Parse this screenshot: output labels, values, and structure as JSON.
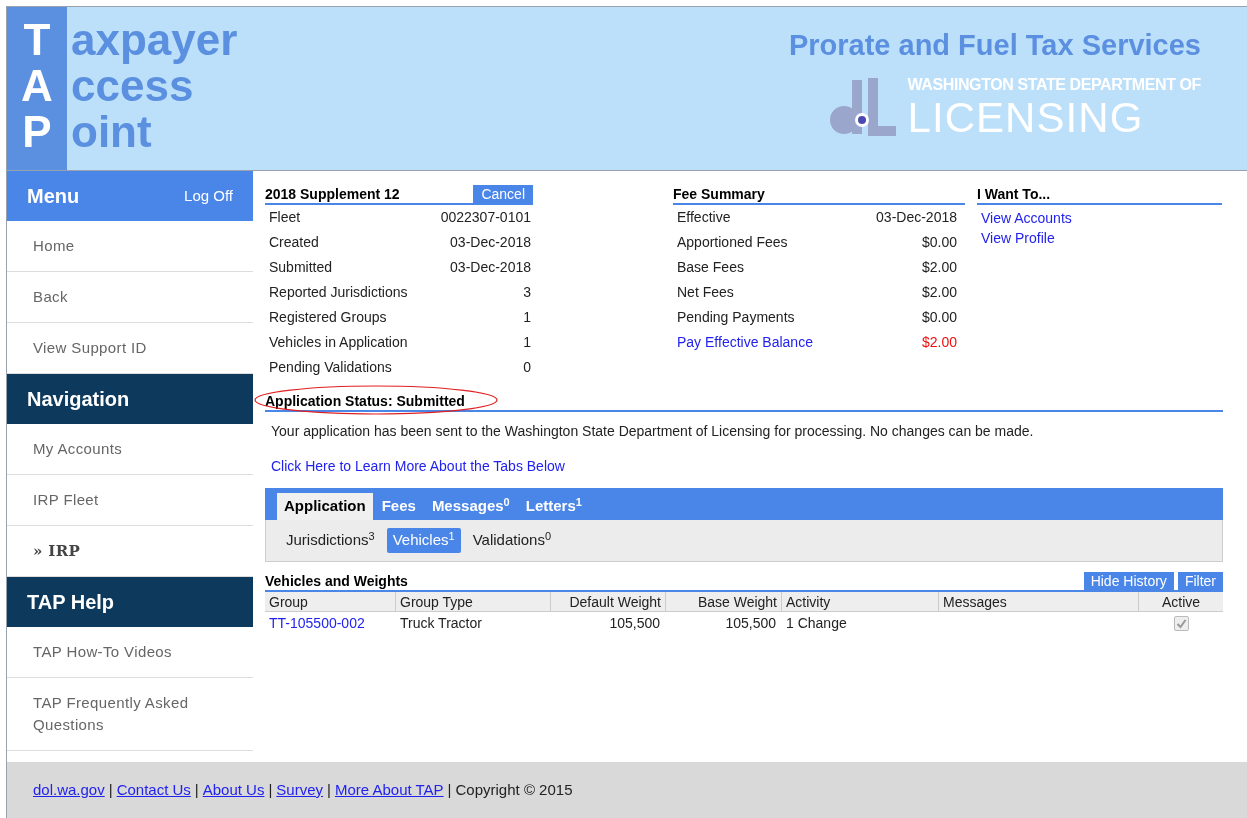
{
  "header": {
    "logo_lines": [
      {
        "initial": "T",
        "rest": "axpayer"
      },
      {
        "initial": "A",
        "rest": "ccess"
      },
      {
        "initial": "P",
        "rest": "oint"
      }
    ],
    "title": "Prorate and Fuel Tax Services",
    "agency_line": "WASHINGTON STATE DEPARTMENT OF",
    "agency_name": "LICENSING"
  },
  "sidebar": {
    "sections": [
      {
        "title": "Menu",
        "action": "Log Off",
        "items": [
          {
            "label": "Home",
            "selected": false
          },
          {
            "label": "Back",
            "selected": false
          },
          {
            "label": "View Support ID",
            "selected": false
          }
        ]
      },
      {
        "title": "Navigation",
        "items": [
          {
            "label": "My Accounts",
            "selected": false
          },
          {
            "label": "IRP Fleet",
            "selected": false
          },
          {
            "label": "» IRP",
            "selected": true
          }
        ]
      },
      {
        "title": "TAP Help",
        "items": [
          {
            "label": "TAP How-To Videos",
            "selected": false
          },
          {
            "label": "TAP Frequently Asked Questions",
            "selected": false
          }
        ]
      }
    ]
  },
  "summary": {
    "title": "2018 Supplement 12",
    "button": "Cancel",
    "rows": [
      {
        "label": "Fleet",
        "value": "0022307-0101"
      },
      {
        "label": "Created",
        "value": "03-Dec-2018"
      },
      {
        "label": "Submitted",
        "value": "03-Dec-2018"
      },
      {
        "label": "Reported Jurisdictions",
        "value": "3"
      },
      {
        "label": "Registered Groups",
        "value": "1"
      },
      {
        "label": "Vehicles in Application",
        "value": "1"
      },
      {
        "label": "Pending Validations",
        "value": "0"
      }
    ]
  },
  "fees": {
    "title": "Fee Summary",
    "rows": [
      {
        "label": "Effective",
        "value": "03-Dec-2018",
        "kind": "plain"
      },
      {
        "label": "Apportioned Fees",
        "value": "$0.00",
        "kind": "plain"
      },
      {
        "label": "Base Fees",
        "value": "$2.00",
        "kind": "plain"
      },
      {
        "label": "Net Fees",
        "value": "$2.00",
        "kind": "plain"
      },
      {
        "label": "Pending Payments",
        "value": "$0.00",
        "kind": "plain"
      },
      {
        "label": "Pay Effective Balance",
        "value": "$2.00",
        "kind": "due"
      }
    ]
  },
  "i_want_to": {
    "title": "I Want To...",
    "links": [
      "View Accounts",
      "View Profile"
    ]
  },
  "status": {
    "title": "Application Status: Submitted",
    "message": "Your application has been sent to the Washington State Department of Licensing for processing. No changes can be made.",
    "help_link": "Click Here to Learn More About the Tabs Below"
  },
  "tabs": [
    {
      "label": "Application",
      "selected": true
    },
    {
      "label": "Fees",
      "selected": false
    },
    {
      "label": "Messages",
      "count": "0",
      "selected": false
    },
    {
      "label": "Letters",
      "count": "1",
      "selected": false
    }
  ],
  "subtabs": [
    {
      "label": "Jurisdictions",
      "count": "3",
      "selected": false
    },
    {
      "label": "Vehicles",
      "count": "1",
      "selected": true
    },
    {
      "label": "Validations",
      "count": "0",
      "selected": false
    }
  ],
  "table": {
    "title": "Vehicles and Weights",
    "buttons": [
      "Hide History",
      "Filter"
    ],
    "columns": [
      "Group",
      "Group Type",
      "Default Weight",
      "Base Weight",
      "Activity",
      "Messages",
      "Active"
    ],
    "rows": [
      {
        "group": "TT-105500-002",
        "group_type": "Truck Tractor",
        "default_weight": "105,500",
        "base_weight": "105,500",
        "activity": "1 Change",
        "active": true
      }
    ]
  },
  "footer": {
    "items": [
      {
        "kind": "link",
        "text": "dol.wa.gov"
      },
      {
        "kind": "text",
        "text": "|"
      },
      {
        "kind": "link",
        "text": "Contact Us"
      },
      {
        "kind": "text",
        "text": "|"
      },
      {
        "kind": "link",
        "text": "About Us"
      },
      {
        "kind": "text",
        "text": "|"
      },
      {
        "kind": "link",
        "text": "Survey"
      },
      {
        "kind": "text",
        "text": "|"
      },
      {
        "kind": "link",
        "text": "More About TAP"
      },
      {
        "kind": "text",
        "text": "|"
      },
      {
        "kind": "text",
        "text": "Copyright © 2015"
      }
    ]
  }
}
